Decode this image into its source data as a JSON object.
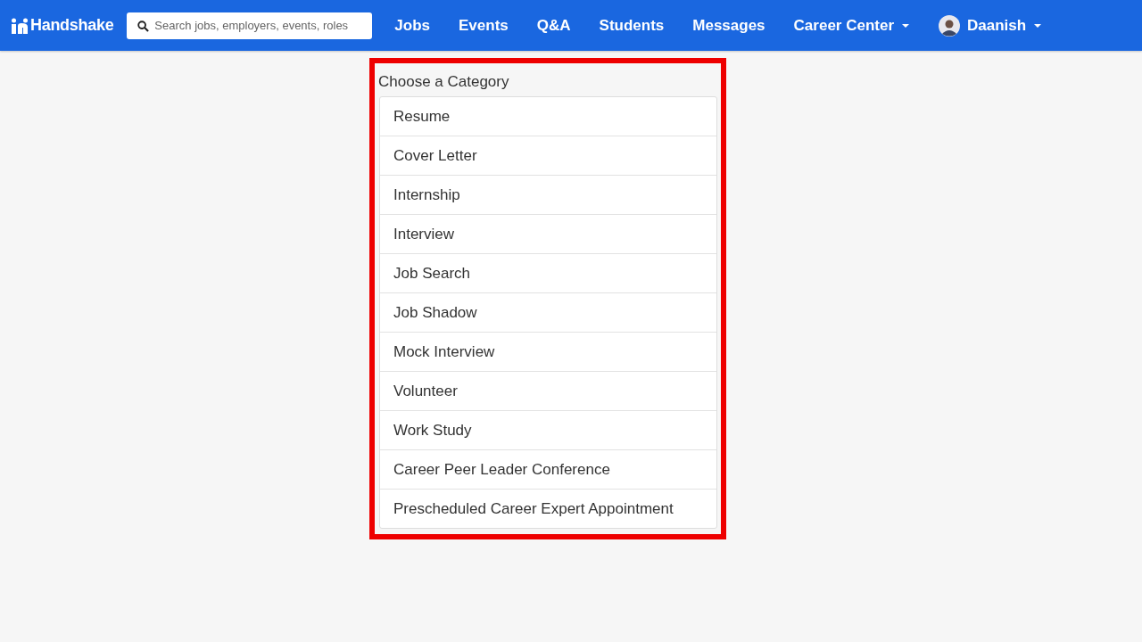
{
  "navbar": {
    "logo": "Handshake",
    "search": {
      "placeholder": "Search jobs, employers, events, roles"
    },
    "items": [
      {
        "label": "Jobs",
        "dropdown": false
      },
      {
        "label": "Events",
        "dropdown": false
      },
      {
        "label": "Q&A",
        "dropdown": false
      },
      {
        "label": "Students",
        "dropdown": false
      },
      {
        "label": "Messages",
        "dropdown": false
      },
      {
        "label": "Career Center",
        "dropdown": true
      }
    ],
    "user": {
      "name": "Daanish",
      "dropdown": true
    }
  },
  "category_picker": {
    "heading": "Choose a Category",
    "highlighted": true,
    "options": [
      "Resume",
      "Cover Letter",
      "Internship",
      "Interview",
      "Job Search",
      "Job Shadow",
      "Mock Interview",
      "Volunteer",
      "Work Study",
      "Career Peer Leader Conference",
      "Prescheduled Career Expert Appointment"
    ]
  }
}
